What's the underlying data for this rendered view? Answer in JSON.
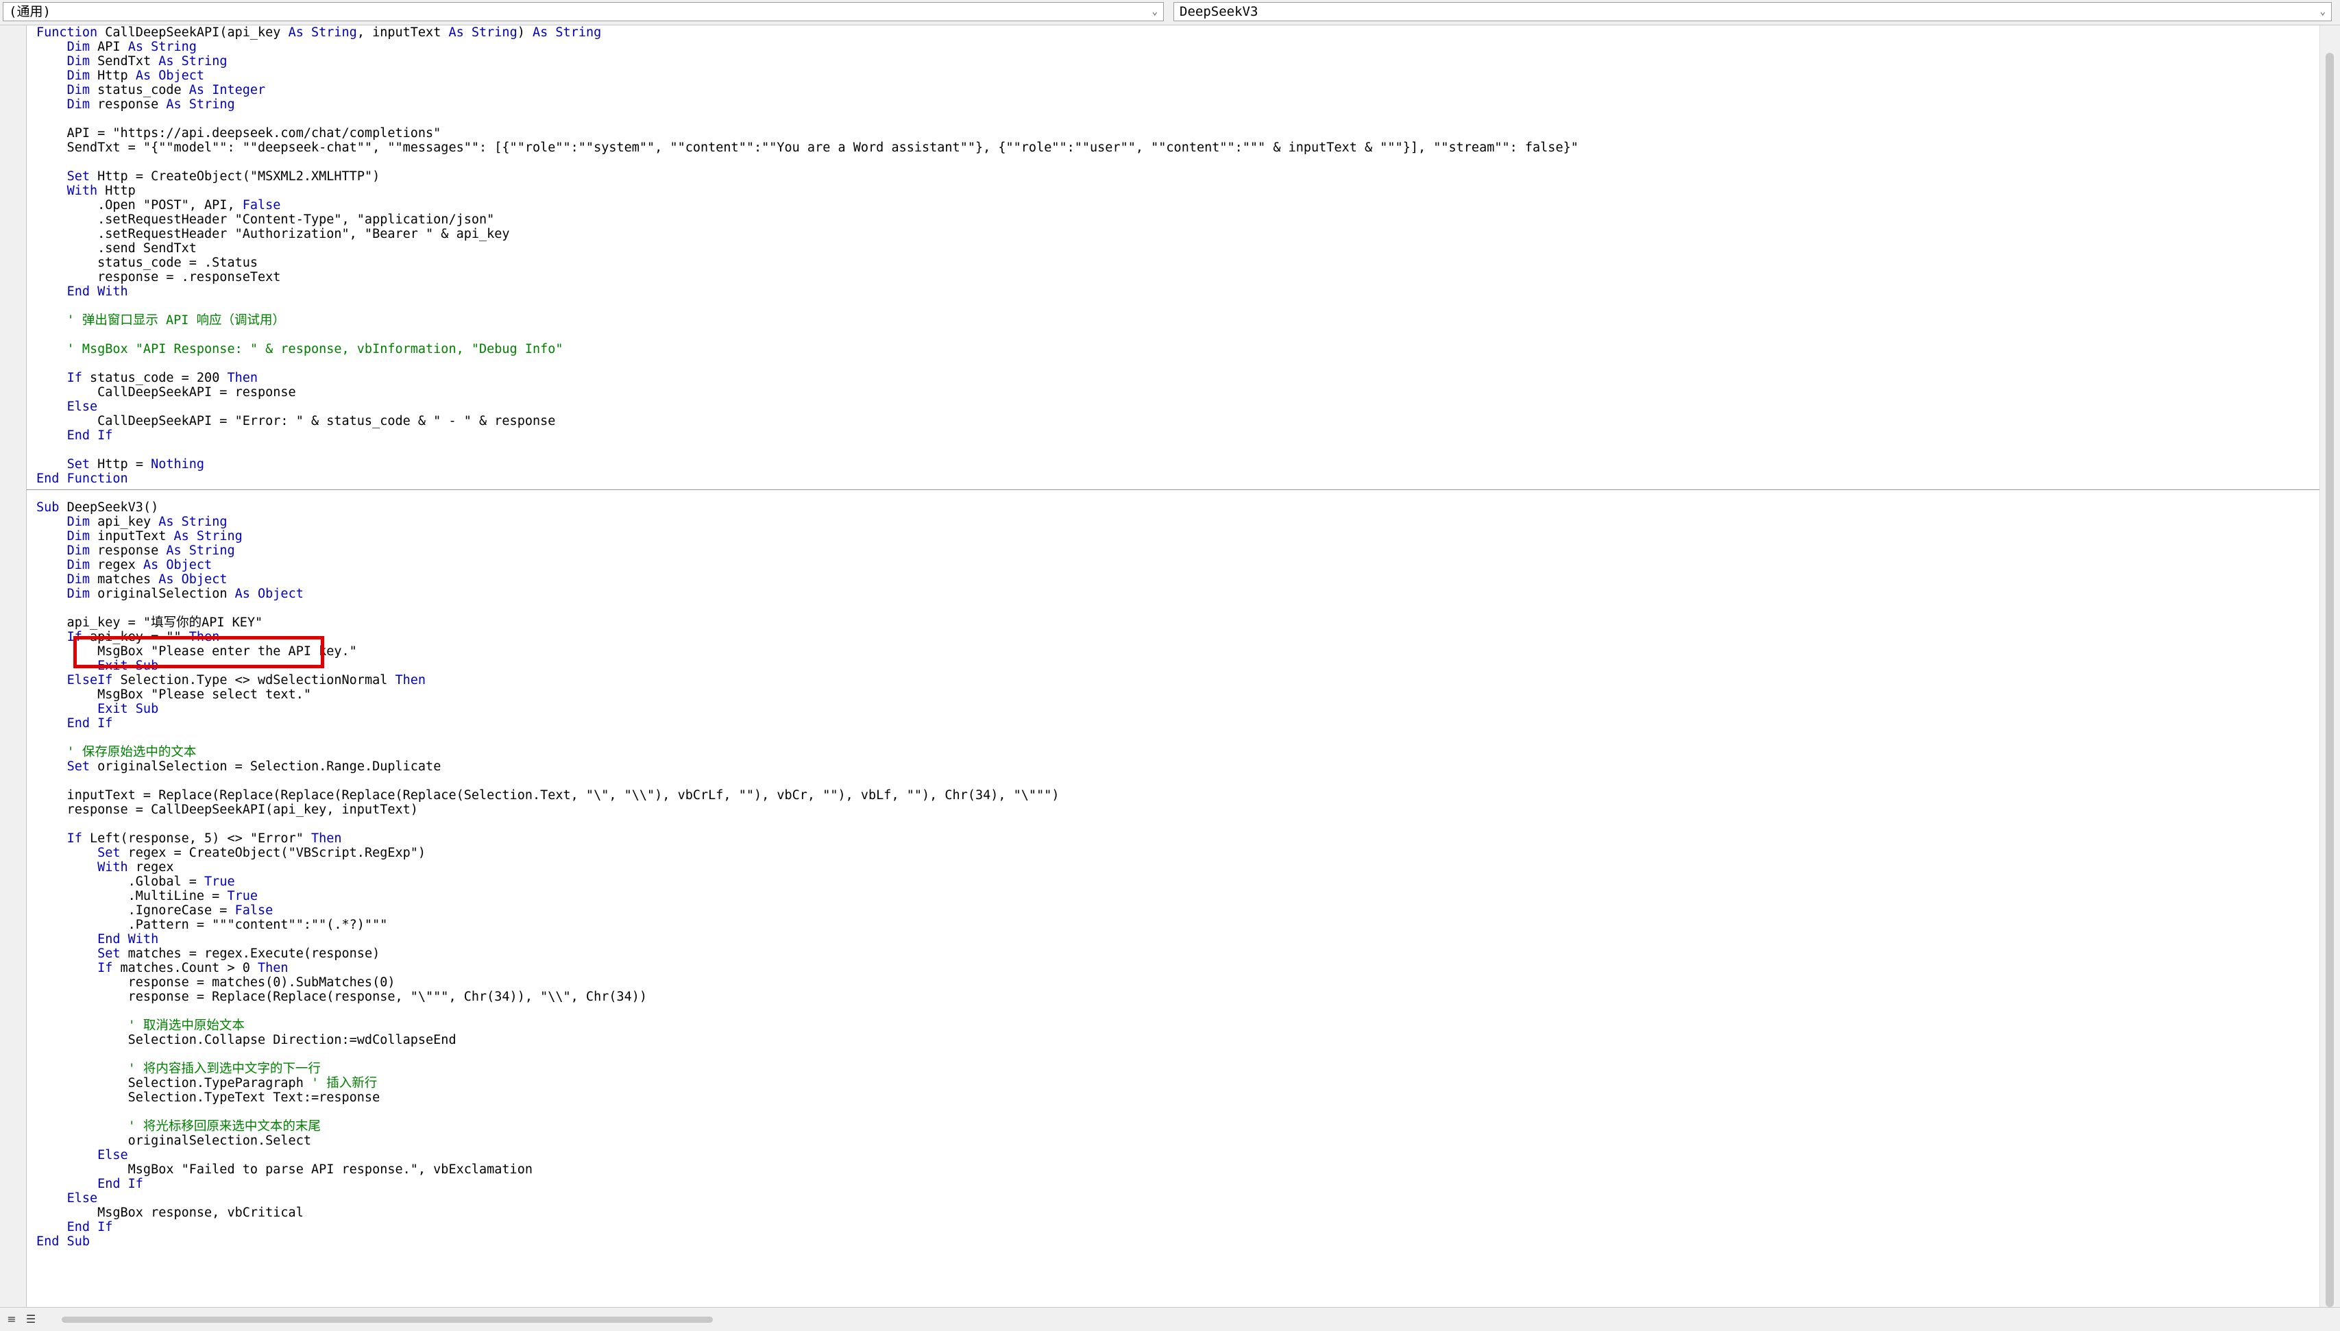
{
  "object_combo": "(通用)",
  "procedure_combo": "DeepSeekV3",
  "code_lines": [
    [
      [
        "kw",
        "Function "
      ],
      [
        "t",
        "CallDeepSeekAPI(api_key "
      ],
      [
        "kw",
        "As String"
      ],
      [
        "t",
        ", inputText "
      ],
      [
        "kw",
        "As String"
      ],
      [
        "t",
        ") "
      ],
      [
        "kw",
        "As String"
      ]
    ],
    [
      [
        "t",
        "    "
      ],
      [
        "kw",
        "Dim "
      ],
      [
        "t",
        "API "
      ],
      [
        "kw",
        "As String"
      ]
    ],
    [
      [
        "t",
        "    "
      ],
      [
        "kw",
        "Dim "
      ],
      [
        "t",
        "SendTxt "
      ],
      [
        "kw",
        "As String"
      ]
    ],
    [
      [
        "t",
        "    "
      ],
      [
        "kw",
        "Dim "
      ],
      [
        "t",
        "Http "
      ],
      [
        "kw",
        "As Object"
      ]
    ],
    [
      [
        "t",
        "    "
      ],
      [
        "kw",
        "Dim "
      ],
      [
        "t",
        "status_code "
      ],
      [
        "kw",
        "As Integer"
      ]
    ],
    [
      [
        "t",
        "    "
      ],
      [
        "kw",
        "Dim "
      ],
      [
        "t",
        "response "
      ],
      [
        "kw",
        "As String"
      ]
    ],
    [],
    [
      [
        "t",
        "    API = \"https://api.deepseek.com/chat/completions\""
      ]
    ],
    [
      [
        "t",
        "    SendTxt = \"{\"\"model\"\": \"\"deepseek-chat\"\", \"\"messages\"\": [{\"\"role\"\":\"\"system\"\", \"\"content\"\":\"\"You are a Word assistant\"\"}, {\"\"role\"\":\"\"user\"\", \"\"content\"\":\"\"\" & inputText & \"\"\"}], \"\"stream\"\": false}\""
      ]
    ],
    [],
    [
      [
        "t",
        "    "
      ],
      [
        "kw",
        "Set "
      ],
      [
        "t",
        "Http = CreateObject(\"MSXML2.XMLHTTP\")"
      ]
    ],
    [
      [
        "t",
        "    "
      ],
      [
        "kw",
        "With "
      ],
      [
        "t",
        "Http"
      ]
    ],
    [
      [
        "t",
        "        .Open \"POST\", API, "
      ],
      [
        "kw",
        "False"
      ]
    ],
    [
      [
        "t",
        "        .setRequestHeader \"Content-Type\", \"application/json\""
      ]
    ],
    [
      [
        "t",
        "        .setRequestHeader \"Authorization\", \"Bearer \" & api_key"
      ]
    ],
    [
      [
        "t",
        "        .send SendTxt"
      ]
    ],
    [
      [
        "t",
        "        status_code = .Status"
      ]
    ],
    [
      [
        "t",
        "        response = .responseText"
      ]
    ],
    [
      [
        "t",
        "    "
      ],
      [
        "kw",
        "End With"
      ]
    ],
    [],
    [
      [
        "cm",
        "    ' 弹出窗口显示 API 响应（调试用）"
      ]
    ],
    [],
    [
      [
        "cm",
        "    ' MsgBox \"API Response: \" & response, vbInformation, \"Debug Info\""
      ]
    ],
    [],
    [
      [
        "t",
        "    "
      ],
      [
        "kw",
        "If "
      ],
      [
        "t",
        "status_code = 200 "
      ],
      [
        "kw",
        "Then"
      ]
    ],
    [
      [
        "t",
        "        CallDeepSeekAPI = response"
      ]
    ],
    [
      [
        "t",
        "    "
      ],
      [
        "kw",
        "Else"
      ]
    ],
    [
      [
        "t",
        "        CallDeepSeekAPI = \"Error: \" & status_code & \" - \" & response"
      ]
    ],
    [
      [
        "t",
        "    "
      ],
      [
        "kw",
        "End If"
      ]
    ],
    [],
    [
      [
        "t",
        "    "
      ],
      [
        "kw",
        "Set "
      ],
      [
        "t",
        "Http = "
      ],
      [
        "kw",
        "Nothing"
      ]
    ],
    [
      [
        "kw",
        "End Function"
      ]
    ],
    [],
    [
      [
        "kw",
        "Sub "
      ],
      [
        "t",
        "DeepSeekV3()"
      ]
    ],
    [
      [
        "t",
        "    "
      ],
      [
        "kw",
        "Dim "
      ],
      [
        "t",
        "api_key "
      ],
      [
        "kw",
        "As String"
      ]
    ],
    [
      [
        "t",
        "    "
      ],
      [
        "kw",
        "Dim "
      ],
      [
        "t",
        "inputText "
      ],
      [
        "kw",
        "As String"
      ]
    ],
    [
      [
        "t",
        "    "
      ],
      [
        "kw",
        "Dim "
      ],
      [
        "t",
        "response "
      ],
      [
        "kw",
        "As String"
      ]
    ],
    [
      [
        "t",
        "    "
      ],
      [
        "kw",
        "Dim "
      ],
      [
        "t",
        "regex "
      ],
      [
        "kw",
        "As Object"
      ]
    ],
    [
      [
        "t",
        "    "
      ],
      [
        "kw",
        "Dim "
      ],
      [
        "t",
        "matches "
      ],
      [
        "kw",
        "As Object"
      ]
    ],
    [
      [
        "t",
        "    "
      ],
      [
        "kw",
        "Dim "
      ],
      [
        "t",
        "originalSelection "
      ],
      [
        "kw",
        "As Object"
      ]
    ],
    [],
    [
      [
        "t",
        "    api_key = \"填写你的API KEY\""
      ]
    ],
    [
      [
        "t",
        "    "
      ],
      [
        "kw",
        "If "
      ],
      [
        "t",
        "api_key = \"\" "
      ],
      [
        "kw",
        "Then"
      ]
    ],
    [
      [
        "t",
        "        MsgBox \"Please enter the API key.\""
      ]
    ],
    [
      [
        "t",
        "        "
      ],
      [
        "kw",
        "Exit Sub"
      ]
    ],
    [
      [
        "t",
        "    "
      ],
      [
        "kw",
        "ElseIf "
      ],
      [
        "t",
        "Selection.Type <> wdSelectionNormal "
      ],
      [
        "kw",
        "Then"
      ]
    ],
    [
      [
        "t",
        "        MsgBox \"Please select text.\""
      ]
    ],
    [
      [
        "t",
        "        "
      ],
      [
        "kw",
        "Exit Sub"
      ]
    ],
    [
      [
        "t",
        "    "
      ],
      [
        "kw",
        "End If"
      ]
    ],
    [],
    [
      [
        "cm",
        "    ' 保存原始选中的文本"
      ]
    ],
    [
      [
        "t",
        "    "
      ],
      [
        "kw",
        "Set "
      ],
      [
        "t",
        "originalSelection = Selection.Range.Duplicate"
      ]
    ],
    [],
    [
      [
        "t",
        "    inputText = Replace(Replace(Replace(Replace(Replace(Selection.Text, \"\\\", \"\\\\\"), vbCrLf, \"\"), vbCr, \"\"), vbLf, \"\"), Chr(34), \"\\\"\"\")"
      ]
    ],
    [
      [
        "t",
        "    response = CallDeepSeekAPI(api_key, inputText)"
      ]
    ],
    [],
    [
      [
        "t",
        "    "
      ],
      [
        "kw",
        "If "
      ],
      [
        "t",
        "Left(response, 5) <> \"Error\" "
      ],
      [
        "kw",
        "Then"
      ]
    ],
    [
      [
        "t",
        "        "
      ],
      [
        "kw",
        "Set "
      ],
      [
        "t",
        "regex = CreateObject(\"VBScript.RegExp\")"
      ]
    ],
    [
      [
        "t",
        "        "
      ],
      [
        "kw",
        "With "
      ],
      [
        "t",
        "regex"
      ]
    ],
    [
      [
        "t",
        "            .Global = "
      ],
      [
        "kw",
        "True"
      ]
    ],
    [
      [
        "t",
        "            .MultiLine = "
      ],
      [
        "kw",
        "True"
      ]
    ],
    [
      [
        "t",
        "            .IgnoreCase = "
      ],
      [
        "kw",
        "False"
      ]
    ],
    [
      [
        "t",
        "            .Pattern = \"\"\"content\"\":\"\"(.*?)\"\"\""
      ]
    ],
    [
      [
        "t",
        "        "
      ],
      [
        "kw",
        "End With"
      ]
    ],
    [
      [
        "t",
        "        "
      ],
      [
        "kw",
        "Set "
      ],
      [
        "t",
        "matches = regex.Execute(response)"
      ]
    ],
    [
      [
        "t",
        "        "
      ],
      [
        "kw",
        "If "
      ],
      [
        "t",
        "matches.Count > 0 "
      ],
      [
        "kw",
        "Then"
      ]
    ],
    [
      [
        "t",
        "            response = matches(0).SubMatches(0)"
      ]
    ],
    [
      [
        "t",
        "            response = Replace(Replace(response, \"\\\"\"\", Chr(34)), \"\\\\\", Chr(34))"
      ]
    ],
    [],
    [
      [
        "cm",
        "            ' 取消选中原始文本"
      ]
    ],
    [
      [
        "t",
        "            Selection.Collapse Direction:=wdCollapseEnd"
      ]
    ],
    [],
    [
      [
        "cm",
        "            ' 将内容插入到选中文字的下一行"
      ]
    ],
    [
      [
        "t",
        "            Selection.TypeParagraph "
      ],
      [
        "cm",
        "' 插入新行"
      ]
    ],
    [
      [
        "t",
        "            Selection.TypeText Text:=response"
      ]
    ],
    [],
    [
      [
        "cm",
        "            ' 将光标移回原来选中文本的末尾"
      ]
    ],
    [
      [
        "t",
        "            originalSelection.Select"
      ]
    ],
    [
      [
        "t",
        "        "
      ],
      [
        "kw",
        "Else"
      ]
    ],
    [
      [
        "t",
        "            MsgBox \"Failed to parse API response.\", vbExclamation"
      ]
    ],
    [
      [
        "t",
        "        "
      ],
      [
        "kw",
        "End If"
      ]
    ],
    [
      [
        "t",
        "    "
      ],
      [
        "kw",
        "Else"
      ]
    ],
    [
      [
        "t",
        "        MsgBox response, vbCritical"
      ]
    ],
    [
      [
        "t",
        "    "
      ],
      [
        "kw",
        "End If"
      ]
    ],
    [
      [
        "kw",
        "End Sub"
      ]
    ]
  ]
}
